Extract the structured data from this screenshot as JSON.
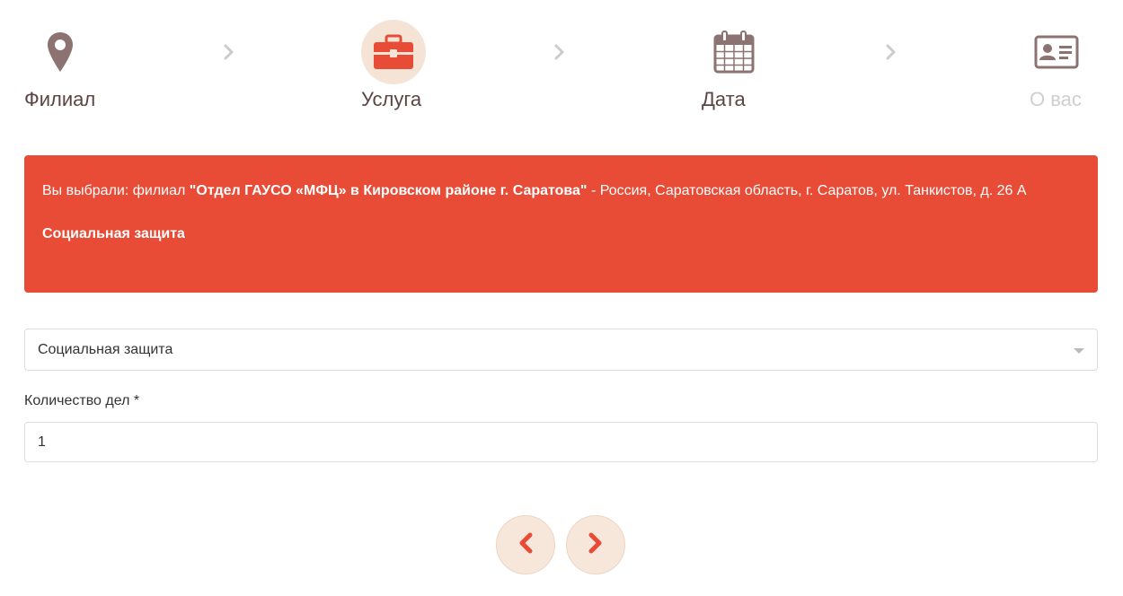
{
  "steps": [
    {
      "label": "Филиал",
      "icon": "map-marker-icon",
      "state": "done"
    },
    {
      "label": "Услуга",
      "icon": "briefcase-icon",
      "state": "active"
    },
    {
      "label": "Дата",
      "icon": "calendar-icon",
      "state": "pending"
    },
    {
      "label": "О вас",
      "icon": "id-card-icon",
      "state": "disabled"
    }
  ],
  "separator_icon": "chevron-right-icon",
  "alert": {
    "prefix": "Вы выбрали: филиал ",
    "branch": "\"Отдел ГАУСО «МФЦ» в Кировском районе г. Саратова\"",
    "address": " - Россия, Саратовская область, г. Саратов, ул. Танкистов, д. 26 А",
    "service": "Социальная защита"
  },
  "service_select": {
    "value": "Социальная защита"
  },
  "count_field": {
    "label": "Количество дел *",
    "value": "1"
  },
  "nav": {
    "prev_icon": "chevron-left-icon",
    "next_icon": "chevron-right-icon"
  },
  "colors": {
    "accent": "#e84c37",
    "step_bg": "#f5e3d6",
    "icon_brown": "#8c7372",
    "label_dark": "#5b4444",
    "label_disabled": "#cfcfcf",
    "separator": "#cccccc"
  }
}
